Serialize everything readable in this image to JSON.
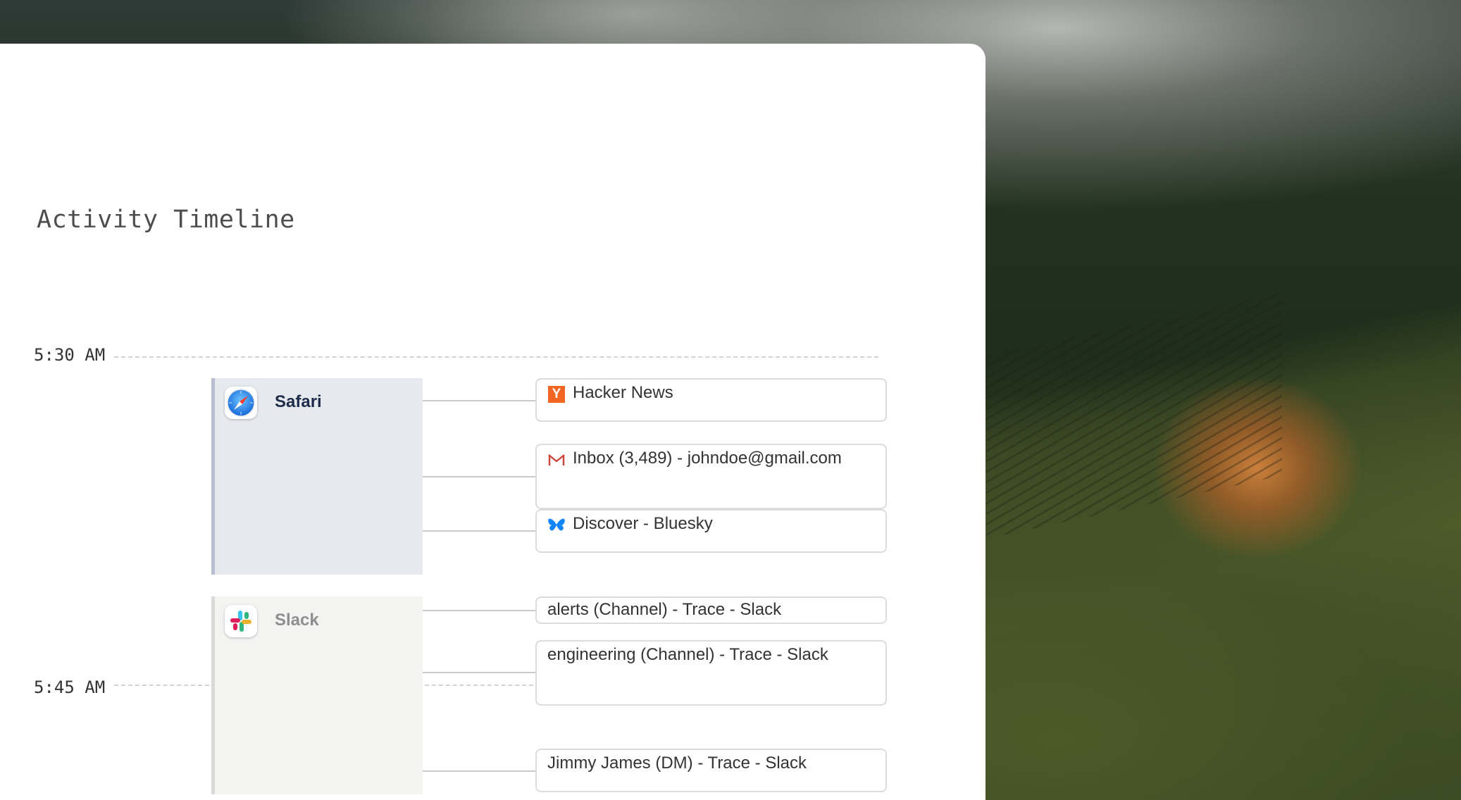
{
  "page": {
    "title": "Activity Timeline"
  },
  "timeline": {
    "times": [
      {
        "label": "5:30 AM"
      },
      {
        "label": "5:45 AM"
      }
    ],
    "apps": [
      {
        "name": "Safari",
        "icon": "safari-icon",
        "state": "active",
        "entries": [
          {
            "icon": "hacker-news-icon",
            "title": "Hacker News"
          },
          {
            "icon": "gmail-icon",
            "title": "Inbox (3,489) - johndoe@gmail.com"
          },
          {
            "icon": "bluesky-butterfly-icon",
            "title": "Discover - Bluesky"
          }
        ]
      },
      {
        "name": "Slack",
        "icon": "slack-icon",
        "state": "inactive",
        "entries": [
          {
            "title": "alerts (Channel) - Trace - Slack"
          },
          {
            "title": "engineering (Channel) - Trace - Slack"
          },
          {
            "title": "Jimmy James (DM) - Trace - Slack"
          }
        ]
      }
    ]
  },
  "colors": {
    "active_block_bg": "#e6e9ed",
    "inactive_block_bg": "#f3f3f2",
    "hacker_news_orange": "#f26522",
    "bluesky_blue": "#1185fe"
  }
}
